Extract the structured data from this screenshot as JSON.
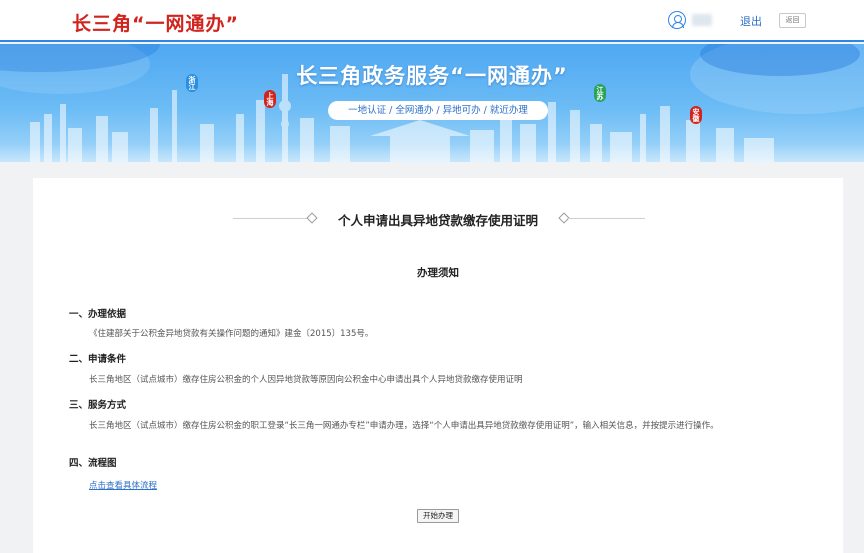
{
  "header": {
    "logo": "长三角“一网通办”",
    "logout_label": "退出",
    "back_label": "返回"
  },
  "banner": {
    "title": "长三角政务服务“一网通办”",
    "slogan": "一地认证 / 全网通办 / 异地可办 / 就近办理",
    "provinces": [
      "浙江",
      "上海",
      "江苏",
      "安徽"
    ]
  },
  "main": {
    "title": "个人申请出具异地贷款缴存使用证明",
    "notice_title": "办理须知",
    "sections": [
      {
        "heading": "一、办理依据",
        "body": "《住建部关于公积金异地贷款有关操作问题的通知》建金〔2015〕135号。"
      },
      {
        "heading": "二、申请条件",
        "body": "长三角地区（试点城市）缴存住房公积金的个人因异地贷款等原因向公积金中心申请出具个人异地贷款缴存使用证明"
      },
      {
        "heading": "三、服务方式",
        "body": "长三角地区（试点城市）缴存住房公积金的职工登录“长三角一网通办专栏”申请办理，选择“个人申请出具异地贷款缴存使用证明”，输入相关信息，并按提示进行操作。"
      },
      {
        "heading": "四、流程图",
        "body": ""
      }
    ],
    "flow_link": "点击查看具体流程",
    "start_button": "开始办理"
  },
  "colors": {
    "brand_red": "#d2241e",
    "accent_blue": "#2d86e6",
    "link_blue": "#2d6fc9"
  }
}
